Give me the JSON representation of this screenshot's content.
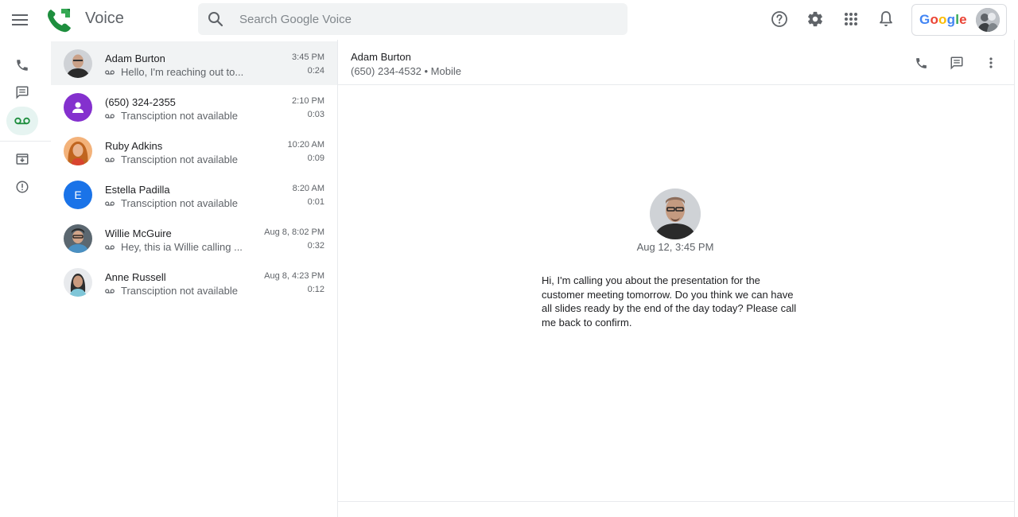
{
  "app": {
    "title": "Voice"
  },
  "search": {
    "placeholder": "Search Google Voice"
  },
  "account": {
    "brand": "Google"
  },
  "colors": {
    "accent": "#1e8e3e",
    "voicemail_active_bg": "#e6f4f1",
    "selected_row": "#f1f3f4"
  },
  "nav": [
    {
      "name": "calls",
      "icon": "phone-icon"
    },
    {
      "name": "messages",
      "icon": "message-icon"
    },
    {
      "name": "voicemail",
      "icon": "voicemail-icon",
      "active": true
    },
    {
      "name": "archive",
      "icon": "archive-icon"
    },
    {
      "name": "spam",
      "icon": "spam-icon"
    }
  ],
  "voicemails": [
    {
      "name": "Adam Burton",
      "preview": "Hello, I'm reaching out to...",
      "time": "3:45 PM",
      "duration": "0:24",
      "avatar": "photo"
    },
    {
      "name": "(650) 324-2355",
      "preview": "Transciption not available",
      "time": "2:10 PM",
      "duration": "0:03",
      "avatar": "person-icon"
    },
    {
      "name": "Ruby Adkins",
      "preview": "Transciption not available",
      "time": "10:20 AM",
      "duration": "0:09",
      "avatar": "photo"
    },
    {
      "name": "Estella Padilla",
      "preview": "Transciption not available",
      "time": "8:20 AM",
      "duration": "0:01",
      "avatar": "E"
    },
    {
      "name": "Willie McGuire",
      "preview": "Hey, this ia Willie calling ...",
      "time": "Aug 8, 8:02 PM",
      "duration": "0:32",
      "avatar": "photo"
    },
    {
      "name": "Anne Russell",
      "preview": "Transciption not available",
      "time": "Aug 8, 4:23 PM",
      "duration": "0:12",
      "avatar": "photo"
    }
  ],
  "detail": {
    "name": "Adam Burton",
    "phone": "(650) 234-4532 • Mobile",
    "date": "Aug 12, 3:45 PM",
    "transcript": "Hi, I'm calling you about the presentation for the customer meeting tomorrow. Do you think we can have all slides ready by the end of the day today? Please call me back to confirm."
  }
}
